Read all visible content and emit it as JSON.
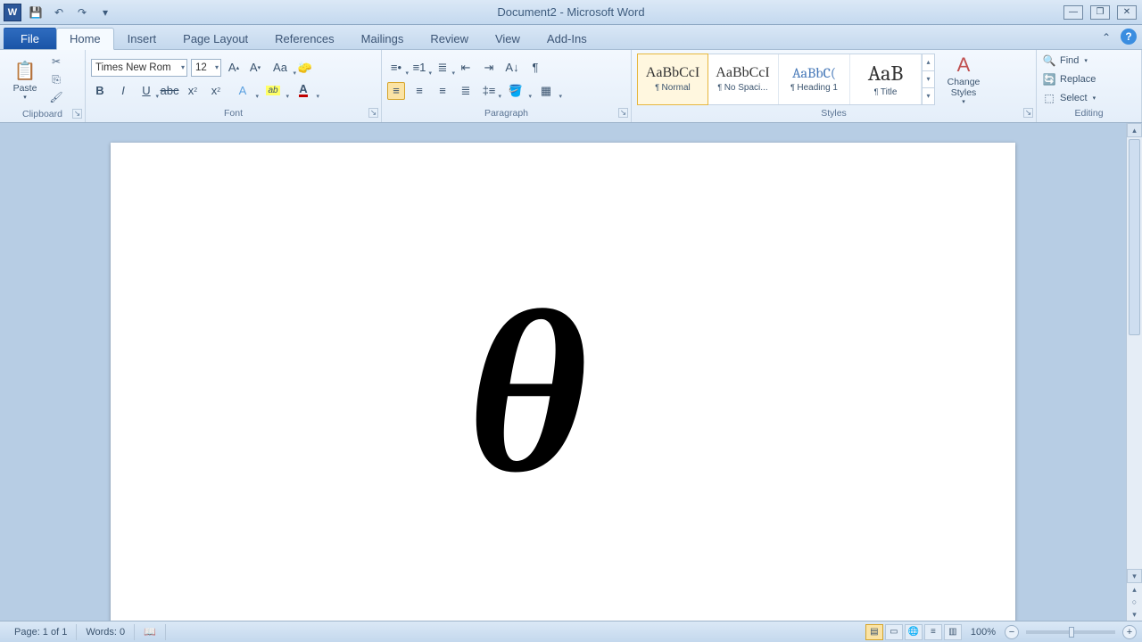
{
  "title": "Document2 - Microsoft Word",
  "qat": {
    "save": "💾",
    "undo": "↶",
    "redo": "↷",
    "more": "▾"
  },
  "tabs": {
    "file": "File",
    "items": [
      "Home",
      "Insert",
      "Page Layout",
      "References",
      "Mailings",
      "Review",
      "View",
      "Add-Ins"
    ],
    "active": "Home"
  },
  "ribbon": {
    "clipboard": {
      "label": "Clipboard",
      "paste": "Paste"
    },
    "font": {
      "label": "Font",
      "name": "Times New Rom",
      "size": "12"
    },
    "paragraph": {
      "label": "Paragraph"
    },
    "styles": {
      "label": "Styles",
      "items": [
        {
          "sample": "AaBbCcI",
          "name": "Normal",
          "cls": ""
        },
        {
          "sample": "AaBbCcI",
          "name": "No Spaci...",
          "cls": ""
        },
        {
          "sample": "AaBbC(",
          "name": "Heading 1",
          "cls": "heading"
        },
        {
          "sample": "AaB",
          "name": "Title",
          "cls": "title"
        }
      ],
      "change": "Change Styles"
    },
    "editing": {
      "label": "Editing",
      "find": "Find",
      "replace": "Replace",
      "select": "Select"
    }
  },
  "document": {
    "content": "θ"
  },
  "status": {
    "page": "Page: 1 of 1",
    "words": "Words: 0",
    "zoom": "100%"
  }
}
